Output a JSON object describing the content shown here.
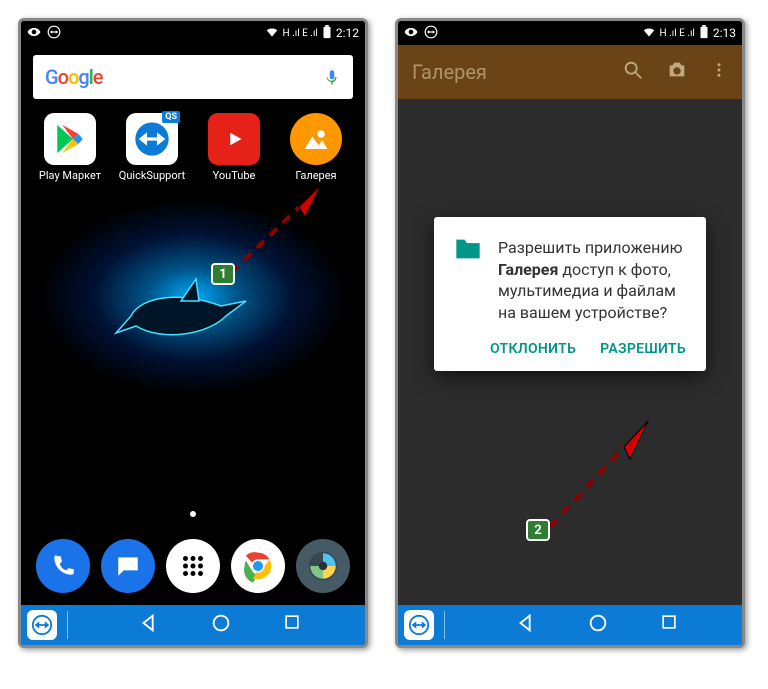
{
  "statusbar_left": {
    "signals": "H .ıl E .ıl",
    "time": "2:12"
  },
  "statusbar_right": {
    "signals": "H .ıl E .ıl",
    "time": "2:13"
  },
  "search": {
    "brand": "Google"
  },
  "apps": [
    {
      "label": "Play Маркет"
    },
    {
      "label": "QuickSupport"
    },
    {
      "label": "YouTube"
    },
    {
      "label": "Галерея"
    }
  ],
  "gallery": {
    "toolbar_title": "Галерея"
  },
  "dialog": {
    "line1": "Разрешить приложению ",
    "bold": "Галерея",
    "line2": " доступ к фото, мультимедиа и файлам на вашем устройстве?",
    "deny": "ОТКЛОНИТЬ",
    "allow": "РАЗРЕШИТЬ"
  },
  "steps": {
    "one": "1",
    "two": "2"
  }
}
